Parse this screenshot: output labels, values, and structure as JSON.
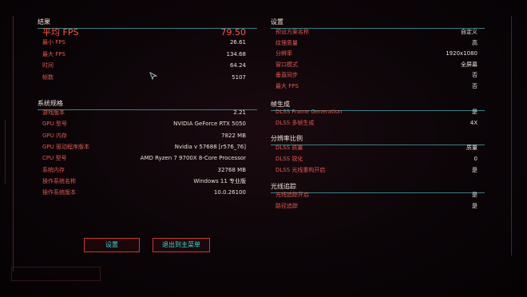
{
  "results": {
    "header": "结果",
    "avg_fps_label": "平均 FPS",
    "avg_fps": "79.50",
    "rows": [
      {
        "label": "最小 FPS",
        "value": "26.61"
      },
      {
        "label": "最大 FPS",
        "value": "134.68"
      },
      {
        "label": "时间",
        "value": "64.24"
      },
      {
        "label": "帧数",
        "value": "5107"
      }
    ]
  },
  "system": {
    "header": "系统规格",
    "rows": [
      {
        "label": "游戏版本",
        "value": "2.21"
      },
      {
        "label": "GPU 型号",
        "value": "NVIDIA GeForce RTX 5050"
      },
      {
        "label": "GPU 内存",
        "value": "7822 MB"
      },
      {
        "label": "GPU 驱动程序版本",
        "value": "Nvidia v 57688 [r576_76]"
      },
      {
        "label": "CPU 型号",
        "value": "AMD Ryzen 7 9700X 8-Core Processor"
      },
      {
        "label": "系统内存",
        "value": "32768 MB"
      },
      {
        "label": "操作系统名称",
        "value": "Windows 11 专业版"
      },
      {
        "label": "操作系统版本",
        "value": "10.0.26100"
      }
    ]
  },
  "settings": {
    "header": "设置",
    "rows": [
      {
        "label": "预设方案名称",
        "value": "自定义"
      },
      {
        "label": "纹理质量",
        "value": "高"
      },
      {
        "label": "分辨率",
        "value": "1920x1080"
      },
      {
        "label": "窗口模式",
        "value": "全屏幕"
      },
      {
        "label": "垂直同步",
        "value": "否"
      },
      {
        "label": "最大 FPS",
        "value": "否"
      }
    ]
  },
  "frame_gen": {
    "header": "帧生成",
    "rows": [
      {
        "label": "DLSS Frame Generation",
        "value": "是"
      },
      {
        "label": "DLSS 多帧生成",
        "value": "4X"
      }
    ]
  },
  "resolution_scaling": {
    "header": "分辨率比例",
    "rows": [
      {
        "label": "DLSS 质量",
        "value": "质量"
      },
      {
        "label": "DLSS 锐化",
        "value": "0"
      },
      {
        "label": "DLSS 光线重构开启",
        "value": "是"
      }
    ]
  },
  "ray_tracing": {
    "header": "光线追踪",
    "rows": [
      {
        "label": "光线追踪开启",
        "value": "是"
      },
      {
        "label": "路径追踪",
        "value": "是"
      }
    ]
  },
  "buttons": {
    "settings": "设置",
    "exit": "退出到主菜单"
  },
  "colors": {
    "accent": "#e05a4e",
    "highlight": "#ff5a4a",
    "button_text": "#3ad8d6",
    "divider": "#3a7f86"
  }
}
